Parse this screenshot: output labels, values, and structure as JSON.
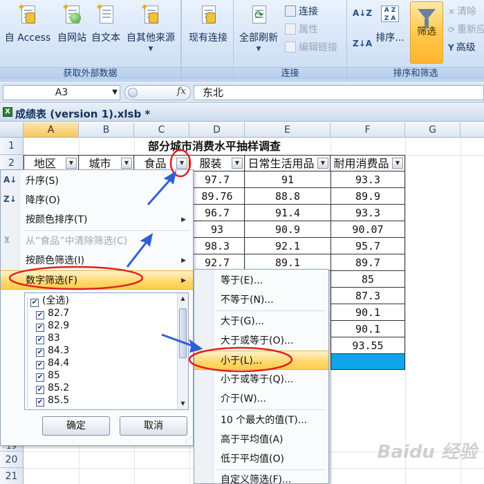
{
  "ribbon": {
    "get_external": {
      "buttons": [
        {
          "label": "自 Access"
        },
        {
          "label": "自网站"
        },
        {
          "label": "自文本"
        },
        {
          "label": "自其他来源"
        }
      ],
      "group_label": "获取外部数据"
    },
    "existing_connections": "现有连接",
    "connections": {
      "refresh_all": "全部刷新",
      "connections": "连接",
      "properties": "属性",
      "edit_links": "编辑链接",
      "group_label": "连接"
    },
    "sort_filter": {
      "sort": "排序...",
      "filter": "筛选",
      "clear": "清除",
      "reapply": "重新应",
      "advanced": "高级",
      "group_label": "排序和筛选"
    }
  },
  "formula_bar": {
    "name_box": "A3",
    "fx": "fx",
    "value": "东北"
  },
  "workbook": {
    "title": "成绩表 (version 1).xlsb *"
  },
  "grid": {
    "columns": [
      "A",
      "B",
      "C",
      "D",
      "E",
      "F",
      "G"
    ],
    "rows": [
      "1",
      "2",
      "19",
      "20",
      "21"
    ],
    "title": "部分城市消费水平抽样调查",
    "headers": [
      "地区",
      "城市",
      "食品",
      "服装",
      "日常生活用品",
      "耐用消费品"
    ],
    "col_d": [
      "97.7",
      "89.76",
      "96.7",
      "93",
      "98.3",
      "92.7"
    ],
    "col_e": [
      "91",
      "88.8",
      "91.4",
      "90.9",
      "92.1",
      "89.1"
    ],
    "col_f": [
      "93.3",
      "89.9",
      "93.3",
      "90.07",
      "95.7",
      "89.7",
      "85",
      "87.3",
      "90.1",
      "90.1",
      "93.55"
    ]
  },
  "filter_menu": {
    "items": [
      {
        "label": "升序(S)",
        "icon": "sort-asc-icon"
      },
      {
        "label": "降序(O)",
        "icon": "sort-desc-icon"
      },
      {
        "label": "按颜色排序(T)"
      },
      {
        "label": "从“食品”中清除筛选(C)",
        "icon": "clear-filter-icon"
      },
      {
        "label": "按颜色筛选(I)"
      },
      {
        "label": "数字筛选(F)"
      }
    ],
    "values": [
      "(全选)",
      "82.7",
      "82.9",
      "83",
      "84.3",
      "84.4",
      "85",
      "85.2",
      "85.5"
    ],
    "ok": "确定",
    "cancel": "取消"
  },
  "number_filter_menu": {
    "items": [
      "等于(E)...",
      "不等于(N)...",
      "大于(G)...",
      "大于或等于(O)...",
      "小于(L)...",
      "小于或等于(Q)...",
      "介于(W)...",
      "10 个最大的值(T)...",
      "高于平均值(A)",
      "低于平均值(O)",
      "自定义筛选(F)..."
    ]
  },
  "colors": {
    "highlight": "#FFD76A",
    "annotation_red": "#E02020",
    "annotation_arrow": "#2F5FD0",
    "selected_cell_fill": "#0FA5E8"
  },
  "watermark": "Baidu 经验"
}
